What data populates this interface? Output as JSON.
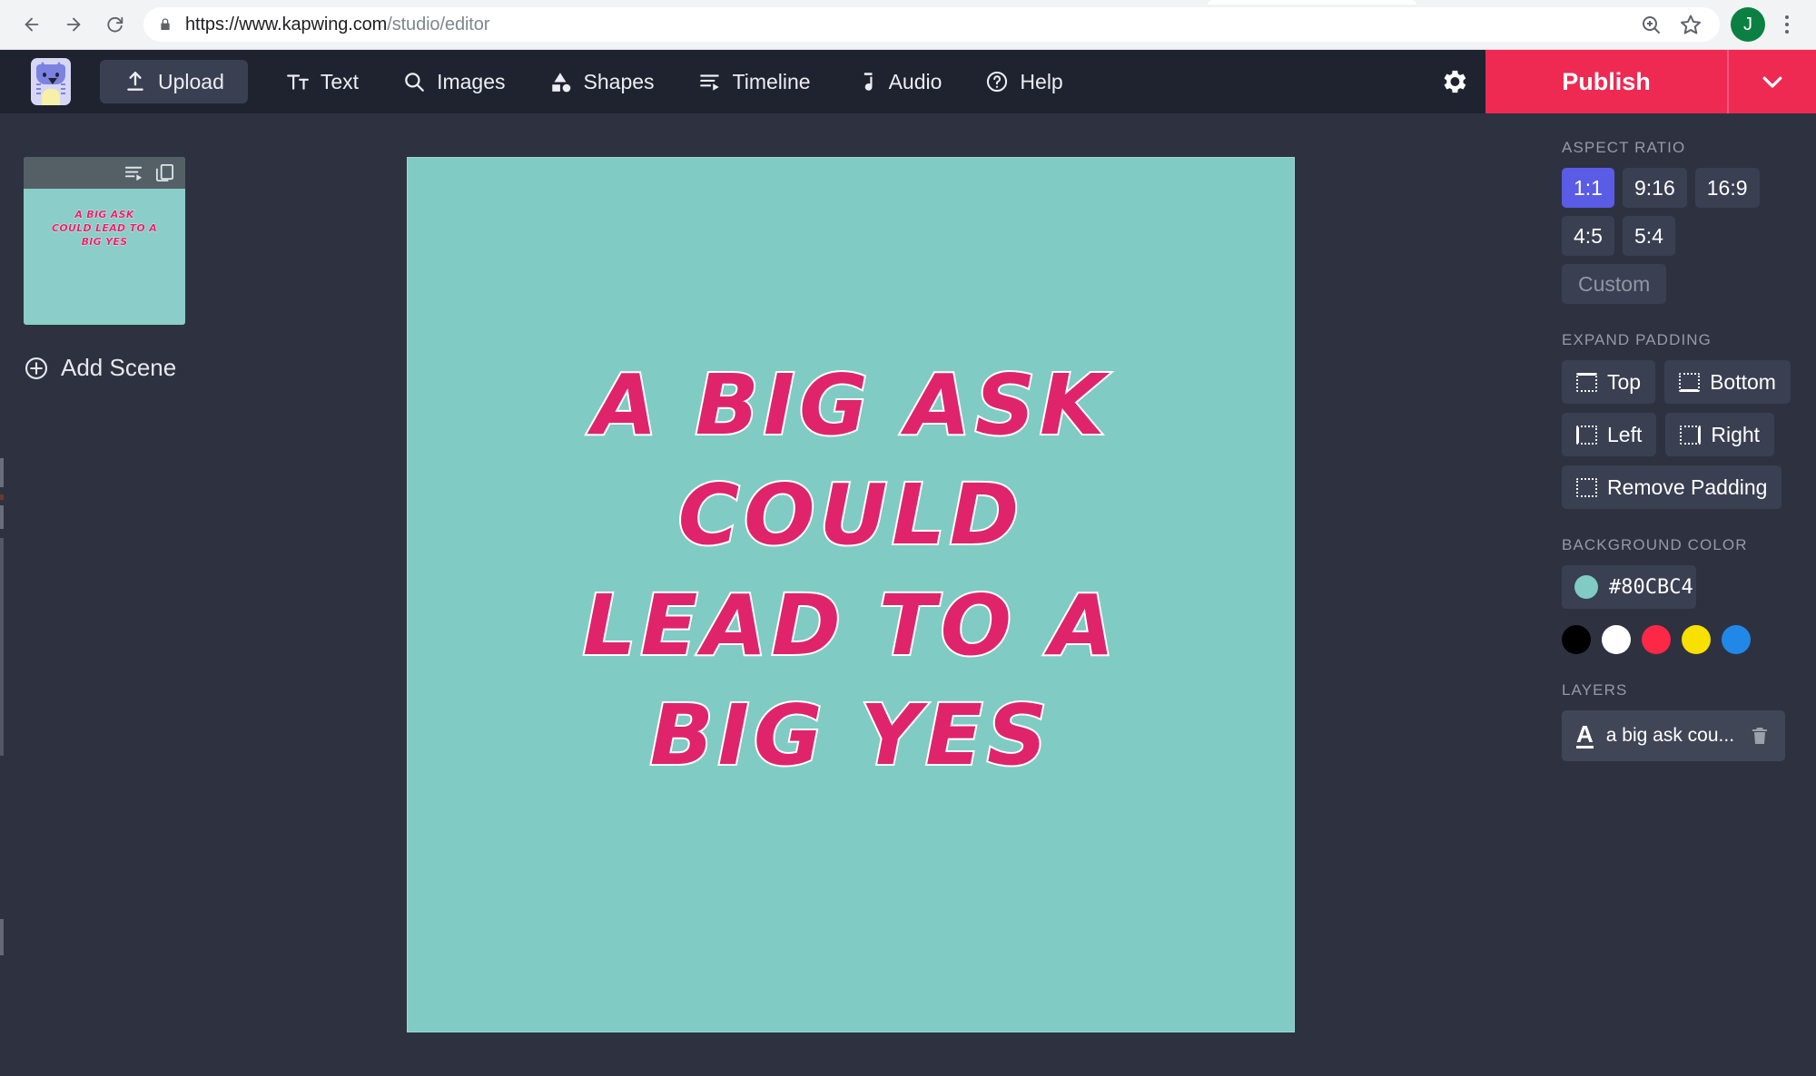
{
  "browser": {
    "url_main": "https://www.kapwing.com",
    "url_path": "/studio/editor",
    "back_icon": "back-arrow-icon",
    "forward_icon": "forward-arrow-icon",
    "reload_icon": "reload-icon",
    "lock_icon": "lock-icon",
    "zoom_icon": "zoom-in-icon",
    "bookmark_icon": "star-icon",
    "avatar_letter": "J",
    "avatar_color": "#0b8043",
    "menu_icon": "kebab-menu-icon"
  },
  "appbar": {
    "logo_name": "kapwing-logo",
    "upload_label": "Upload",
    "tools": [
      {
        "label": "Text",
        "icon": "text-icon"
      },
      {
        "label": "Images",
        "icon": "search-icon"
      },
      {
        "label": "Shapes",
        "icon": "shapes-icon"
      },
      {
        "label": "Timeline",
        "icon": "timeline-icon"
      },
      {
        "label": "Audio",
        "icon": "music-note-icon"
      },
      {
        "label": "Help",
        "icon": "help-circle-icon"
      }
    ],
    "settings_icon": "gear-icon",
    "publish_label": "Publish",
    "publish_caret_icon": "chevron-down-icon",
    "publish_color": "#ee2a53"
  },
  "scenes": {
    "thumb_timeline_icon": "timeline-icon",
    "thumb_duplicate_icon": "duplicate-icon",
    "thumb_text": "A BIG ASK\nCOULD LEAD TO A\nBIG YES",
    "thumb_bg": "#8bcdc8",
    "add_scene_label": "Add Scene",
    "add_scene_icon": "plus-circle-icon"
  },
  "canvas": {
    "background_color": "#80cbc4",
    "text_color": "#e0246b",
    "outline_color": "#ffffff",
    "lines": [
      "A BIG ASK",
      "COULD",
      "LEAD TO A",
      "BIG YES"
    ]
  },
  "panel": {
    "aspect_title": "ASPECT RATIO",
    "aspect_options": [
      {
        "label": "1:1",
        "state": "active"
      },
      {
        "label": "9:16",
        "state": "normal"
      },
      {
        "label": "16:9",
        "state": "normal"
      },
      {
        "label": "4:5",
        "state": "normal"
      },
      {
        "label": "5:4",
        "state": "normal"
      },
      {
        "label": "Custom",
        "state": "muted"
      }
    ],
    "active_aspect_color": "#5a5ce6",
    "padding_title": "EXPAND PADDING",
    "padding_buttons": [
      {
        "label": "Top",
        "icon": "padding-top-icon"
      },
      {
        "label": "Bottom",
        "icon": "padding-bottom-icon"
      },
      {
        "label": "Left",
        "icon": "padding-left-icon"
      },
      {
        "label": "Right",
        "icon": "padding-right-icon"
      },
      {
        "label": "Remove Padding",
        "icon": "padding-remove-icon"
      }
    ],
    "bgcolor_title": "BACKGROUND COLOR",
    "bgcolor_value": "#80CBC4",
    "swatches": [
      "#000000",
      "#ffffff",
      "#fc2846",
      "#f8e000",
      "#2188e8"
    ],
    "layers_title": "LAYERS",
    "layer_icon": "text-layer-icon",
    "layer_name": "a big ask cou...",
    "layer_delete_icon": "trash-icon"
  }
}
